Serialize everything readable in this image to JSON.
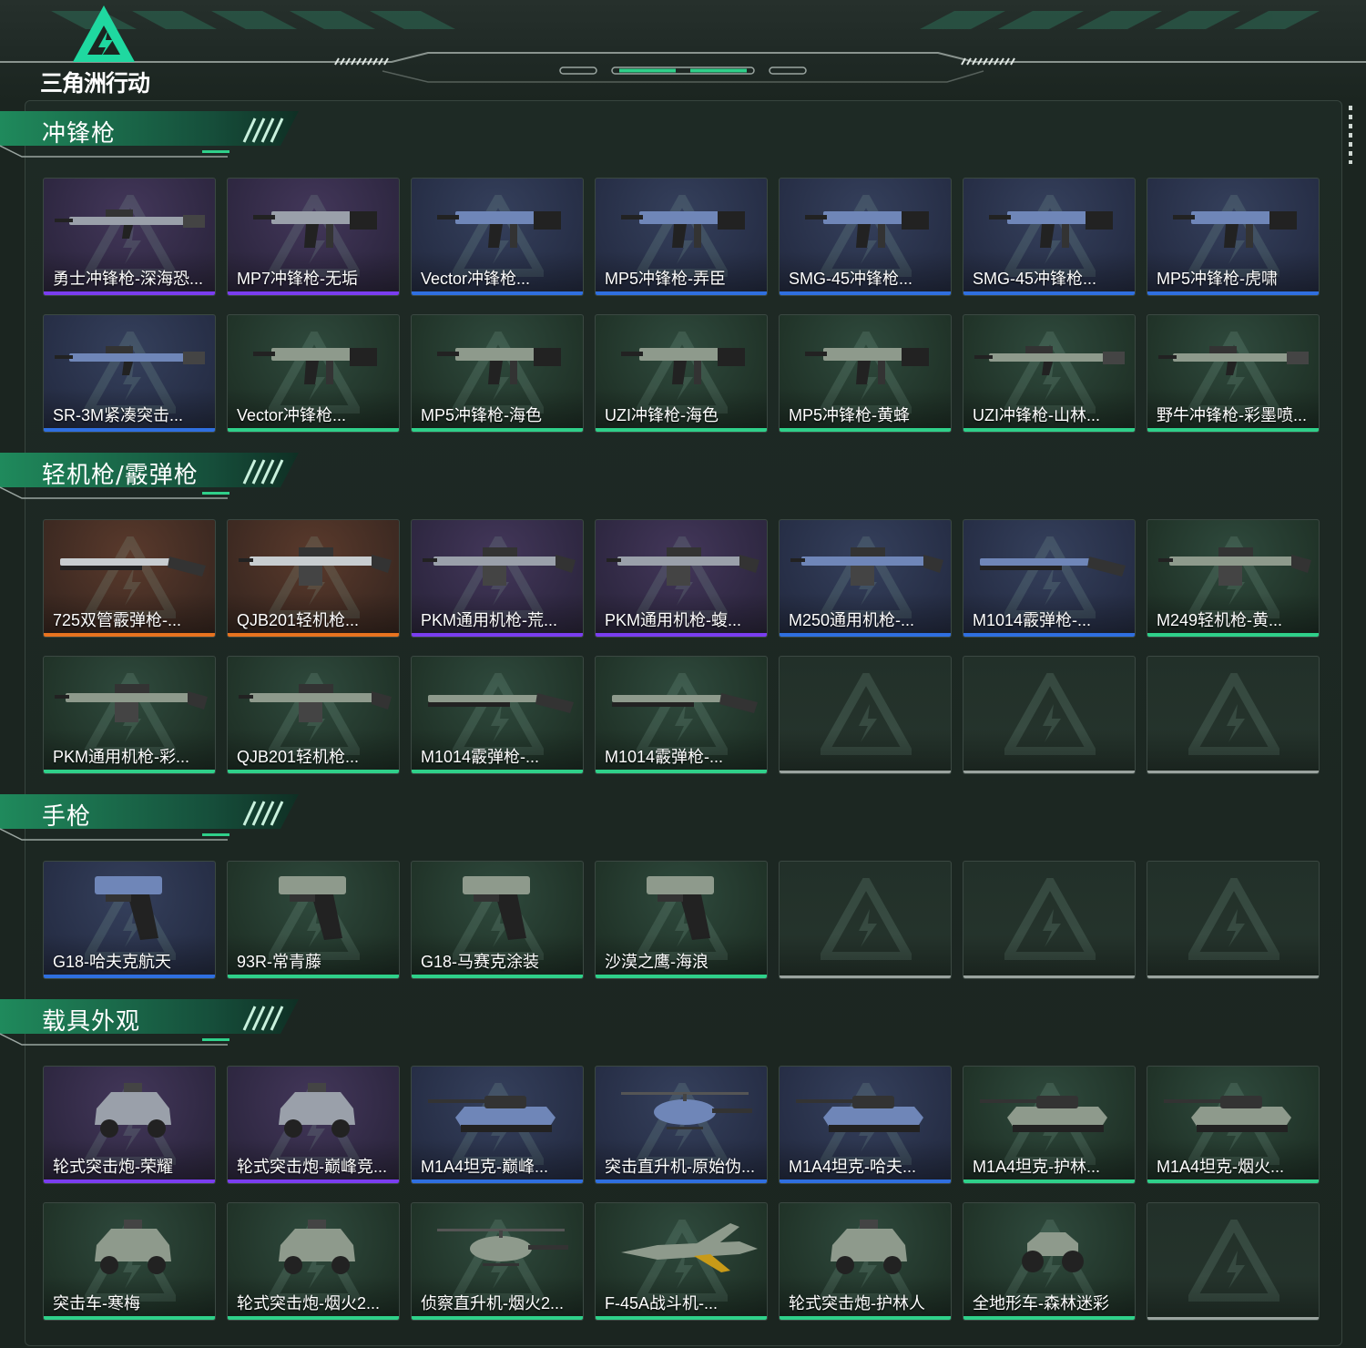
{
  "app": {
    "logo_text": "三角洲行动"
  },
  "colors": {
    "accent": "#2fd08a",
    "rarity_purple": "#7a3df0",
    "rarity_blue": "#2f6fe0",
    "rarity_green": "#2fd08a",
    "rarity_orange": "#e8731f",
    "empty": "#9aa39f"
  },
  "sections": [
    {
      "title": "冲锋枪",
      "items": [
        {
          "name": "勇士冲锋枪-深海恐...",
          "rarity": "purple",
          "icon": "rifle-icon"
        },
        {
          "name": "MP7冲锋枪-无垢",
          "rarity": "purple",
          "icon": "smg-icon"
        },
        {
          "name": "Vector冲锋枪...",
          "rarity": "blue",
          "icon": "smg-icon"
        },
        {
          "name": "MP5冲锋枪-弄臣",
          "rarity": "blue",
          "icon": "smg-icon"
        },
        {
          "name": "SMG-45冲锋枪...",
          "rarity": "blue",
          "icon": "smg-icon"
        },
        {
          "name": "SMG-45冲锋枪...",
          "rarity": "blue",
          "icon": "smg-icon"
        },
        {
          "name": "MP5冲锋枪-虎啸",
          "rarity": "blue",
          "icon": "smg-icon"
        },
        {
          "name": "SR-3M紧凑突击...",
          "rarity": "blue",
          "icon": "rifle-icon"
        },
        {
          "name": "Vector冲锋枪...",
          "rarity": "green",
          "icon": "smg-icon"
        },
        {
          "name": "MP5冲锋枪-海色",
          "rarity": "green",
          "icon": "smg-icon"
        },
        {
          "name": "UZI冲锋枪-海色",
          "rarity": "green",
          "icon": "smg-icon"
        },
        {
          "name": "MP5冲锋枪-黄蜂",
          "rarity": "green",
          "icon": "smg-icon"
        },
        {
          "name": "UZI冲锋枪-山林...",
          "rarity": "green",
          "icon": "rifle-icon"
        },
        {
          "name": "野牛冲锋枪-彩墨喷...",
          "rarity": "green",
          "icon": "rifle-icon"
        }
      ]
    },
    {
      "title": "轻机枪/霰弹枪",
      "items": [
        {
          "name": "725双管霰弹枪-...",
          "rarity": "orange",
          "icon": "shotgun-icon"
        },
        {
          "name": "QJB201轻机枪...",
          "rarity": "orange",
          "icon": "lmg-icon"
        },
        {
          "name": "PKM通用机枪-荒...",
          "rarity": "purple",
          "icon": "lmg-icon"
        },
        {
          "name": "PKM通用机枪-蝮...",
          "rarity": "purple",
          "icon": "lmg-icon"
        },
        {
          "name": "M250通用机枪-...",
          "rarity": "blue",
          "icon": "lmg-icon"
        },
        {
          "name": "M1014霰弹枪-...",
          "rarity": "blue",
          "icon": "shotgun-icon"
        },
        {
          "name": "M249轻机枪-黄...",
          "rarity": "green",
          "icon": "lmg-icon"
        },
        {
          "name": "PKM通用机枪-彩...",
          "rarity": "green",
          "icon": "lmg-icon"
        },
        {
          "name": "QJB201轻机枪...",
          "rarity": "green",
          "icon": "lmg-icon"
        },
        {
          "name": "M1014霰弹枪-...",
          "rarity": "green",
          "icon": "shotgun-icon"
        },
        {
          "name": "M1014霰弹枪-...",
          "rarity": "green",
          "icon": "shotgun-icon"
        },
        {
          "name": "",
          "rarity": "empty",
          "icon": ""
        },
        {
          "name": "",
          "rarity": "empty",
          "icon": ""
        },
        {
          "name": "",
          "rarity": "empty",
          "icon": ""
        }
      ]
    },
    {
      "title": "手枪",
      "items": [
        {
          "name": "G18-哈夫克航天",
          "rarity": "blue",
          "icon": "pistol-icon"
        },
        {
          "name": "93R-常青藤",
          "rarity": "green",
          "icon": "pistol-icon"
        },
        {
          "name": "G18-马赛克涂装",
          "rarity": "green",
          "icon": "pistol-icon"
        },
        {
          "name": "沙漠之鹰-海浪",
          "rarity": "green",
          "icon": "pistol-icon"
        },
        {
          "name": "",
          "rarity": "empty",
          "icon": ""
        },
        {
          "name": "",
          "rarity": "empty",
          "icon": ""
        },
        {
          "name": "",
          "rarity": "empty",
          "icon": ""
        }
      ]
    },
    {
      "title": "载具外观",
      "items": [
        {
          "name": "轮式突击炮-荣耀",
          "rarity": "purple",
          "icon": "armored-car-icon"
        },
        {
          "name": "轮式突击炮-巅峰竞...",
          "rarity": "purple",
          "icon": "armored-car-icon"
        },
        {
          "name": "M1A4坦克-巅峰...",
          "rarity": "blue",
          "icon": "tank-icon"
        },
        {
          "name": "突击直升机-原始伪...",
          "rarity": "blue",
          "icon": "helicopter-icon"
        },
        {
          "name": "M1A4坦克-哈夫...",
          "rarity": "blue",
          "icon": "tank-icon"
        },
        {
          "name": "M1A4坦克-护林...",
          "rarity": "green",
          "icon": "tank-icon"
        },
        {
          "name": "M1A4坦克-烟火...",
          "rarity": "green",
          "icon": "tank-icon"
        },
        {
          "name": "突击车-寒梅",
          "rarity": "green",
          "icon": "armored-car-icon"
        },
        {
          "name": "轮式突击炮-烟火2...",
          "rarity": "green",
          "icon": "armored-car-icon"
        },
        {
          "name": "侦察直升机-烟火2...",
          "rarity": "green",
          "icon": "helicopter-icon"
        },
        {
          "name": "F-45A战斗机-...",
          "rarity": "green",
          "icon": "jet-icon"
        },
        {
          "name": "轮式突击炮-护林人",
          "rarity": "green",
          "icon": "armored-car-icon"
        },
        {
          "name": "全地形车-森林迷彩",
          "rarity": "green",
          "icon": "atv-icon"
        },
        {
          "name": "",
          "rarity": "empty",
          "icon": ""
        }
      ]
    }
  ]
}
